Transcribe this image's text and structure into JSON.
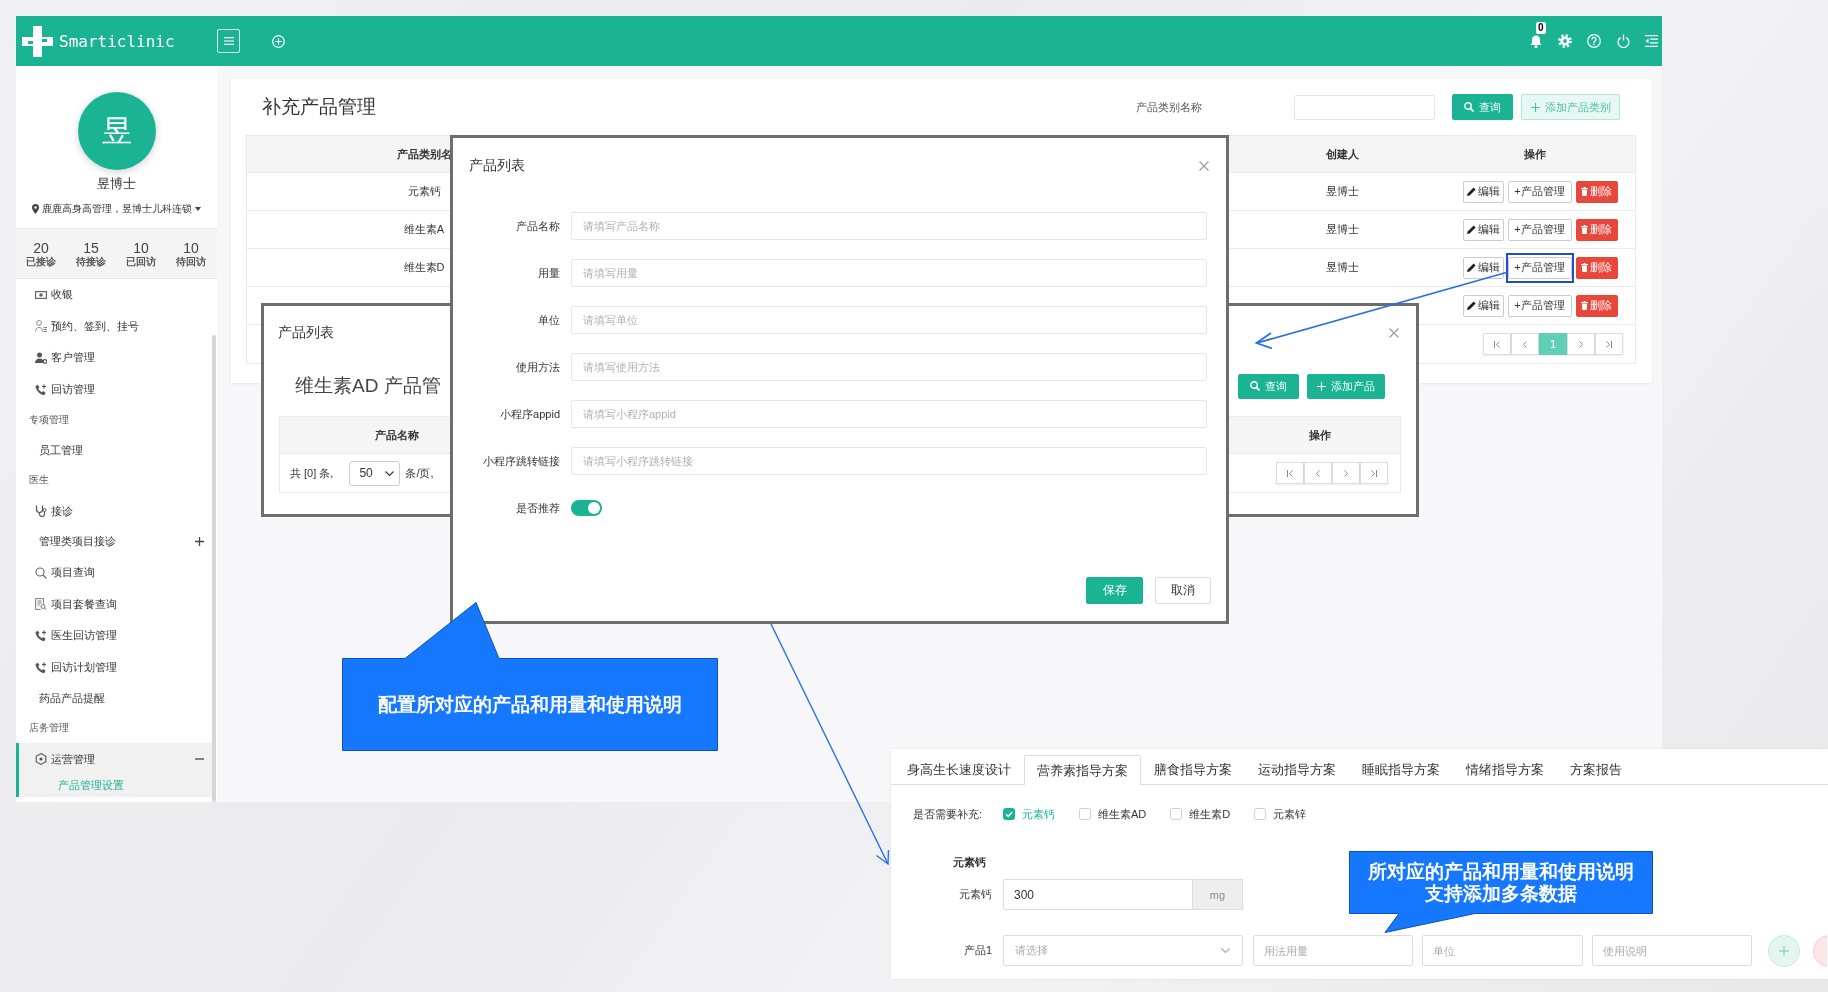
{
  "header": {
    "logo": "Smarticlinic",
    "notification_count": "0"
  },
  "sidebar": {
    "avatar": "昱",
    "user_name": "昱博士",
    "location": "鹿鹿高身高管理，昱博士儿科连锁",
    "stats": [
      {
        "value": "20",
        "label": "已接诊"
      },
      {
        "value": "15",
        "label": "待接诊"
      },
      {
        "value": "10",
        "label": "已回访"
      },
      {
        "value": "10",
        "label": "待回访"
      }
    ],
    "items": [
      {
        "kind": "item",
        "label": "收银",
        "selected": false
      },
      {
        "kind": "item",
        "label": "预约、签到、挂号",
        "selected": false
      },
      {
        "kind": "item",
        "label": "客户管理",
        "selected": false
      },
      {
        "kind": "item",
        "label": "回访管理",
        "selected": false
      },
      {
        "kind": "heading",
        "label": "专项管理"
      },
      {
        "kind": "subitem",
        "label": "员工管理",
        "selected": false
      },
      {
        "kind": "heading",
        "label": "医生"
      },
      {
        "kind": "item",
        "label": "接诊",
        "selected": false
      },
      {
        "kind": "subitem",
        "label": "管理类项目接诊",
        "selected": false,
        "expanded": false
      },
      {
        "kind": "item",
        "label": "项目查询",
        "selected": false
      },
      {
        "kind": "item",
        "label": "项目套餐查询",
        "selected": false
      },
      {
        "kind": "item",
        "label": "医生回访管理",
        "selected": false
      },
      {
        "kind": "item",
        "label": "回访计划管理",
        "selected": false
      },
      {
        "kind": "subitem",
        "label": "药品产品提醒",
        "selected": false
      },
      {
        "kind": "heading",
        "label": "店务管理"
      },
      {
        "kind": "item",
        "label": "运营管理",
        "selected": false,
        "expanded": true,
        "children": [
          {
            "label": "产品管理设置",
            "selected": true
          }
        ]
      }
    ]
  },
  "page": {
    "title": "补充产品管理",
    "search_label": "产品类别名称",
    "buttons": [
      {
        "kind": "search",
        "label": "查询"
      },
      {
        "kind": "add",
        "label": "添加产品类别"
      }
    ],
    "table": {
      "columns": [
        "产品类别名",
        "创建人",
        "操作"
      ],
      "rows": [
        {
          "name": "元素钙",
          "creator": "昱博士",
          "actions": [
            {
              "kind": "edit",
              "label": "编辑",
              "highlighted": false
            },
            {
              "kind": "manage",
              "label": "+产品管理",
              "highlighted": false
            },
            {
              "kind": "delete",
              "label": "删除",
              "highlighted": false
            }
          ]
        },
        {
          "name": "维生素A",
          "creator": "昱博士",
          "actions": [
            {
              "kind": "edit",
              "label": "编辑",
              "highlighted": false
            },
            {
              "kind": "manage",
              "label": "+产品管理",
              "highlighted": false
            },
            {
              "kind": "delete",
              "label": "删除",
              "highlighted": false
            }
          ]
        },
        {
          "name": "维生素D",
          "creator": "昱博士",
          "actions": [
            {
              "kind": "edit",
              "label": "编辑",
              "highlighted": false
            },
            {
              "kind": "manage",
              "label": "+产品管理",
              "highlighted": true
            },
            {
              "kind": "delete",
              "label": "删除",
              "highlighted": false
            }
          ]
        },
        {
          "actions": [
            {
              "kind": "edit",
              "label": "编辑",
              "highlighted": false
            },
            {
              "kind": "manage",
              "label": "+产品管理",
              "highlighted": false
            },
            {
              "kind": "delete",
              "label": "删除",
              "highlighted": false
            }
          ]
        }
      ]
    },
    "pagination": {
      "pages": [
        {
          "label": "1",
          "selected": true
        }
      ]
    }
  },
  "list_dialog": {
    "title": "产品列表",
    "heading": "维生素AD 产品管",
    "buttons": [
      {
        "kind": "search",
        "label": "查询"
      },
      {
        "kind": "add",
        "label": "添加产品"
      }
    ],
    "columns": [
      "产品名称",
      "操作"
    ],
    "total": "共 [0] 条,",
    "page_size": "50",
    "per_page": "条/页,"
  },
  "form_dialog": {
    "title": "产品列表",
    "fields": [
      {
        "label": "产品名称",
        "placeholder": "请填写产品名称"
      },
      {
        "label": "用量",
        "placeholder": "请填写用量"
      },
      {
        "label": "单位",
        "placeholder": "请填写单位"
      },
      {
        "label": "使用方法",
        "placeholder": "请填写使用方法"
      },
      {
        "label": "小程序appid",
        "placeholder": "请填写小程序appid"
      },
      {
        "label": "小程序跳转链接",
        "placeholder": "请填写小程序跳转链接"
      }
    ],
    "recommend": {
      "label": "是否推荐",
      "on": true
    },
    "buttons": [
      {
        "kind": "primary",
        "label": "保存"
      },
      {
        "kind": "default",
        "label": "取消"
      }
    ]
  },
  "callouts": [
    {
      "lines": [
        "配置所对应的产品和用量和使用说明"
      ]
    },
    {
      "lines": [
        "所对应的产品和用量和使用说明",
        "支持添加多条数据"
      ]
    }
  ],
  "plan_panel": {
    "tabs": [
      {
        "label": "身高生长速度设计",
        "selected": false
      },
      {
        "label": "营养素指导方案",
        "selected": true
      },
      {
        "label": "膳食指导方案",
        "selected": false
      },
      {
        "label": "运动指导方案",
        "selected": false
      },
      {
        "label": "睡眠指导方案",
        "selected": false
      },
      {
        "label": "情绪指导方案",
        "selected": false
      },
      {
        "label": "方案报告",
        "selected": false
      }
    ],
    "supplement_label": "是否需要补充:",
    "supplements": [
      {
        "label": "元素钙",
        "checked": true
      },
      {
        "label": "维生素AD",
        "checked": false
      },
      {
        "label": "维生素D",
        "checked": false
      },
      {
        "label": "元素锌",
        "checked": false
      }
    ],
    "section_title": "元素钙",
    "dose": {
      "label": "元素钙",
      "value": "300",
      "unit": "mg"
    },
    "product": {
      "label": "产品1",
      "select": {
        "placeholder": "请选择"
      },
      "fields": [
        {
          "placeholder": "用法用量"
        },
        {
          "placeholder": "单位"
        },
        {
          "placeholder": "使用说明"
        }
      ]
    }
  }
}
